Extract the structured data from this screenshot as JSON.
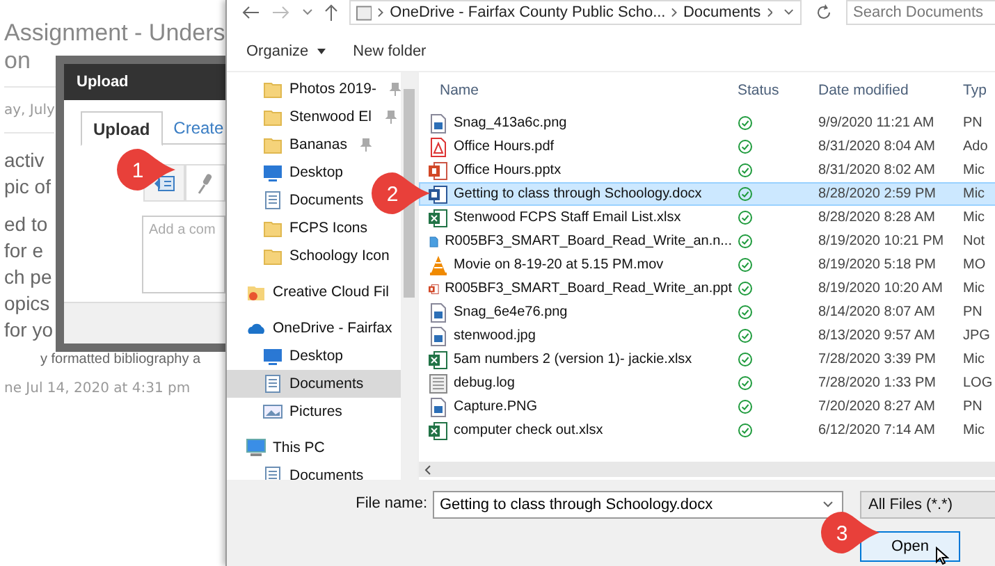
{
  "background_page": {
    "title_lines": [
      "Assignment - Unders",
      "on"
    ],
    "date_fragment": "ay, July",
    "body_fragments": [
      "activ",
      "pic of",
      "ed to",
      "for e",
      "ch pe",
      "opics",
      "for yo"
    ],
    "bibliography_fragment": "y formatted bibliography a",
    "timestamp": "ne Jul 14, 2020 at 4:31 pm"
  },
  "upload_modal": {
    "title": "Upload",
    "tabs": [
      {
        "label": "Upload",
        "selected": true
      },
      {
        "label": "Create",
        "selected": false
      }
    ],
    "comment": {
      "placeholder": "Add a com"
    }
  },
  "file_dialog": {
    "address": [
      "OneDrive - Fairfax County Public Scho...",
      "Documents"
    ],
    "search": {
      "placeholder": "Search Documents"
    },
    "toolbar": [
      "Organize",
      "New folder"
    ],
    "nav_items": [
      {
        "label": "Photos 2019-",
        "kind": "folder",
        "pinned": true,
        "selected": false
      },
      {
        "label": "Stenwood El",
        "kind": "folder",
        "pinned": true,
        "selected": false
      },
      {
        "label": "Bananas",
        "kind": "folder",
        "pinned": true,
        "selected": false
      },
      {
        "label": "Desktop",
        "kind": "desktop",
        "pinned": false,
        "selected": false
      },
      {
        "label": "Documents",
        "kind": "documents",
        "pinned": false,
        "selected": false
      },
      {
        "label": "FCPS Icons",
        "kind": "folder",
        "pinned": false,
        "selected": false
      },
      {
        "label": "Schoology Icon",
        "kind": "folder",
        "pinned": false,
        "selected": false
      },
      {
        "label": "Creative Cloud Fil",
        "kind": "cloud-folder",
        "selected": false
      },
      {
        "label": "OneDrive - Fairfax",
        "kind": "cloud",
        "selected": false,
        "children": [
          {
            "label": "Desktop",
            "kind": "desktop",
            "selected": false
          },
          {
            "label": "Documents",
            "kind": "documents",
            "selected": true
          },
          {
            "label": "Pictures",
            "kind": "pictures",
            "selected": false
          }
        ]
      },
      {
        "label": "This PC",
        "kind": "computer",
        "selected": false,
        "children": [
          {
            "label": "Documents",
            "kind": "documents",
            "selected": false
          }
        ]
      }
    ],
    "columns": [
      "Name",
      "Status",
      "Date modified",
      "Typ"
    ],
    "files": [
      {
        "name": "Snag_413a6c.png",
        "kind": "image",
        "date": "9/9/2020 11:21 AM",
        "type": "PN",
        "selected": false
      },
      {
        "name": "Office Hours.pdf",
        "kind": "pdf",
        "date": "8/31/2020 8:04 AM",
        "type": "Ado",
        "selected": false
      },
      {
        "name": "Office Hours.pptx",
        "kind": "slides",
        "date": "8/31/2020 8:02 AM",
        "type": "Mic",
        "selected": false
      },
      {
        "name": "Getting to class through Schoology.docx",
        "kind": "word",
        "date": "8/28/2020 2:59 PM",
        "type": "Mic",
        "selected": true
      },
      {
        "name": "Stenwood FCPS Staff Email List.xlsx",
        "kind": "sheet",
        "date": "8/28/2020 8:28 AM",
        "type": "Mic",
        "selected": false
      },
      {
        "name": "R005BF3_SMART_Board_Read_Write_an.n...",
        "kind": "note",
        "date": "8/19/2020 10:21 PM",
        "type": "Not",
        "selected": false
      },
      {
        "name": "Movie on 8-19-20 at 5.15 PM.mov",
        "kind": "video",
        "date": "8/19/2020 5:18 PM",
        "type": "MO",
        "selected": false
      },
      {
        "name": "R005BF3_SMART_Board_Read_Write_an.ppt",
        "kind": "slides",
        "date": "8/19/2020 10:20 AM",
        "type": "Mic",
        "selected": false
      },
      {
        "name": "Snag_6e4e76.png",
        "kind": "image",
        "date": "8/14/2020 8:07 AM",
        "type": "PN",
        "selected": false
      },
      {
        "name": "stenwood.jpg",
        "kind": "image",
        "date": "8/13/2020 9:57 AM",
        "type": "JPG",
        "selected": false
      },
      {
        "name": "5am numbers 2 (version 1)- jackie.xlsx",
        "kind": "sheet",
        "date": "7/28/2020 3:39 PM",
        "type": "Mic",
        "selected": false
      },
      {
        "name": "debug.log",
        "kind": "log",
        "date": "7/28/2020 1:33 PM",
        "type": "LOG",
        "selected": false
      },
      {
        "name": "Capture.PNG",
        "kind": "image",
        "date": "7/20/2020 8:27 AM",
        "type": "PN",
        "selected": false
      },
      {
        "name": "computer check out.xlsx",
        "kind": "sheet",
        "date": "6/12/2020 7:14 AM",
        "type": "Mic",
        "selected": false
      }
    ],
    "file_name": {
      "label": "File name:",
      "value": "Getting to class through Schoology.docx"
    },
    "file_type": "All Files (*.*)",
    "open_button": "Open"
  },
  "callouts": [
    "1",
    "2",
    "3"
  ]
}
